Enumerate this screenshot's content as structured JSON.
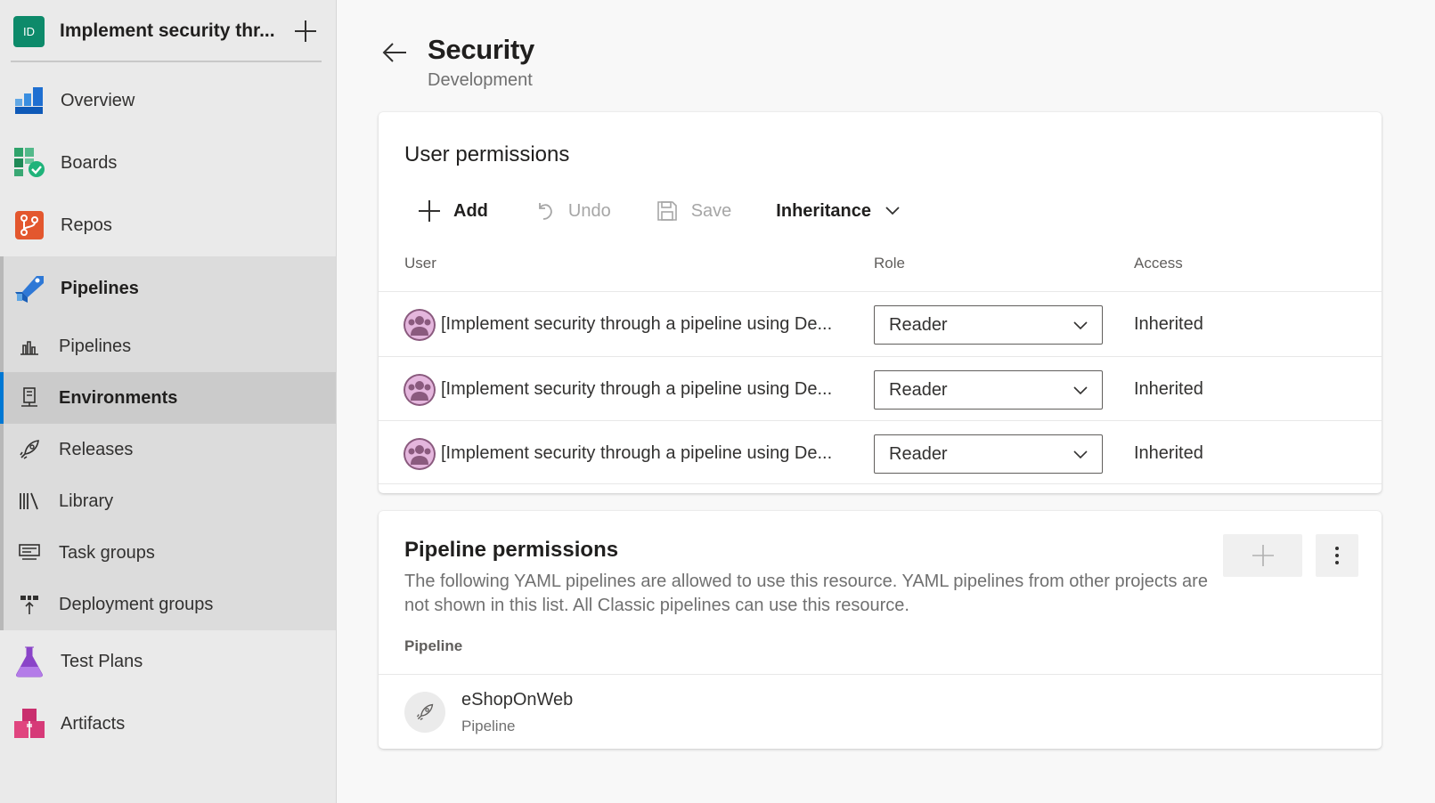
{
  "project": {
    "initials": "ID",
    "name": "Implement security thr..."
  },
  "nav": {
    "overview": "Overview",
    "boards": "Boards",
    "repos": "Repos",
    "pipelines": "Pipelines",
    "sub": {
      "pipelines": "Pipelines",
      "environments": "Environments",
      "releases": "Releases",
      "library": "Library",
      "task_groups": "Task groups",
      "deployment_groups": "Deployment groups"
    },
    "test_plans": "Test Plans",
    "artifacts": "Artifacts"
  },
  "page": {
    "title": "Security",
    "subtitle": "Development"
  },
  "user_permissions": {
    "title": "User permissions",
    "toolbar": {
      "add": "Add",
      "undo": "Undo",
      "save": "Save",
      "inheritance": "Inheritance"
    },
    "columns": {
      "user": "User",
      "role": "Role",
      "access": "Access"
    },
    "rows": [
      {
        "user": "[Implement security through a pipeline using De...",
        "role": "Reader",
        "access": "Inherited"
      },
      {
        "user": "[Implement security through a pipeline using De...",
        "role": "Reader",
        "access": "Inherited"
      },
      {
        "user": "[Implement security through a pipeline using De...",
        "role": "Reader",
        "access": "Inherited"
      }
    ]
  },
  "pipeline_permissions": {
    "title": "Pipeline permissions",
    "description": "The following YAML pipelines are allowed to use this resource. YAML pipelines from other projects are not shown in this list. All Classic pipelines can use this resource.",
    "column": "Pipeline",
    "items": [
      {
        "name": "eShopOnWeb",
        "type": "Pipeline"
      }
    ]
  },
  "colors": {
    "accent": "#0078d4",
    "project_badge": "#0d8a6a"
  }
}
